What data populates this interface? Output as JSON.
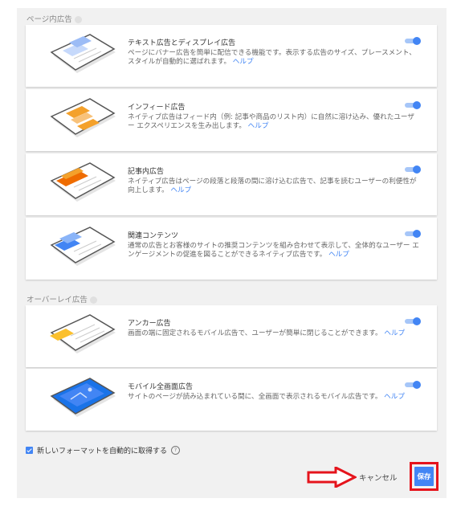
{
  "sections": {
    "in_page_title": "ページ内広告",
    "overlay_title": "オーバーレイ広告"
  },
  "cards": [
    {
      "title": "テキスト広告とディスプレイ広告",
      "desc": "ページにバナー広告を簡単に配信できる機能です。表示する広告のサイズ、プレースメント、スタイルが自動的に選ばれます。",
      "link": "ヘルプ"
    },
    {
      "title": "インフィード広告",
      "desc": "ネイティブ広告はフィード内（例: 記事や商品のリスト内）に自然に溶け込み、優れたユーザー エクスペリエンスを生み出します。",
      "link": "ヘルプ"
    },
    {
      "title": "記事内広告",
      "desc": "ネイティブ広告はページの段落と段落の間に溶け込む広告で、記事を読むユーザーの利便性が向上します。",
      "link": "ヘルプ"
    },
    {
      "title": "関連コンテンツ",
      "desc": "通常の広告とお客様のサイトの推奨コンテンツを組み合わせて表示して、全体的なユーザー エンゲージメントの促進を図ることができるネイティブ広告です。",
      "link": "ヘルプ"
    },
    {
      "title": "アンカー広告",
      "desc": "画面の端に固定されるモバイル広告で、ユーザーが簡単に閉じることができます。",
      "link": "ヘルプ"
    },
    {
      "title": "モバイル全画面広告",
      "desc": "サイトのページが読み込まれている間に、全画面で表示されるモバイル広告です。",
      "link": "ヘルプ"
    }
  ],
  "auto_format": {
    "label": "新しいフォーマットを自動的に取得する",
    "checked": true,
    "help": "?"
  },
  "actions": {
    "cancel": "キャンセル",
    "save": "保存"
  },
  "colors": {
    "accent": "#4285f4",
    "highlight_box": "#e5141c",
    "orange": "#f4a12b",
    "yellow": "#fbc02d"
  }
}
